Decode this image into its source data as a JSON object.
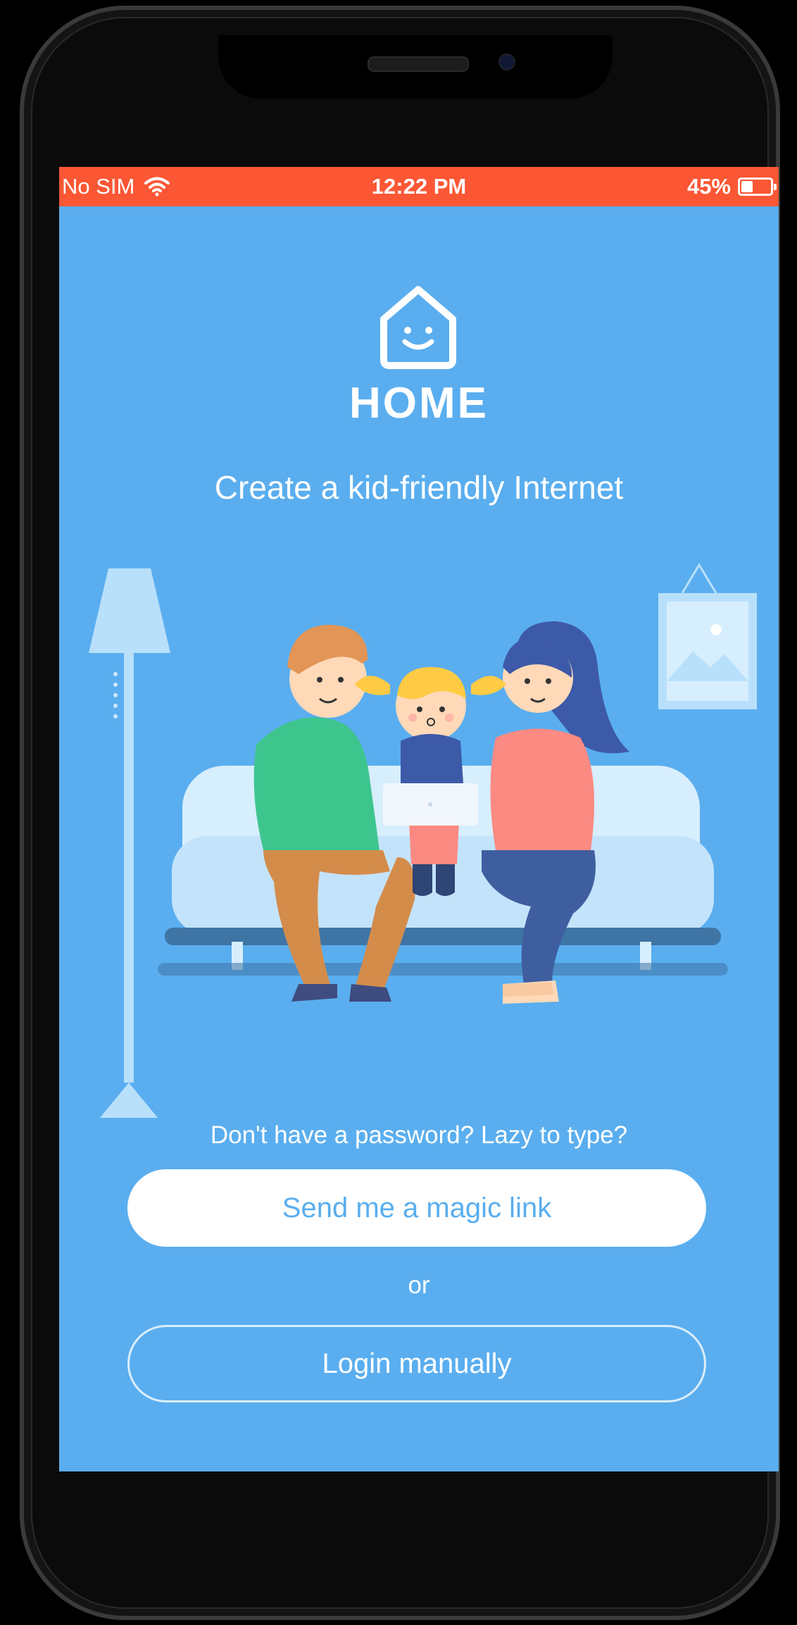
{
  "status_bar": {
    "carrier": "No SIM",
    "time": "12:22 PM",
    "battery_percent": "45%",
    "battery_level": 0.45,
    "wifi_icon": "wifi-icon",
    "background_color": "#fb5735"
  },
  "header": {
    "logo_icon": "house-smile-icon",
    "brand": "HOME",
    "tagline": "Create a kid-friendly Internet"
  },
  "illustration": {
    "icon": "family-on-sofa-illustration"
  },
  "auth": {
    "prompt": "Don't have a password? Lazy to type?",
    "magic_link_label": "Send me a magic link",
    "or_label": "or",
    "login_label": "Login manually"
  },
  "colors": {
    "background": "#5aaeef",
    "accent": "#fb5735",
    "button_text": "#5aaeef"
  }
}
